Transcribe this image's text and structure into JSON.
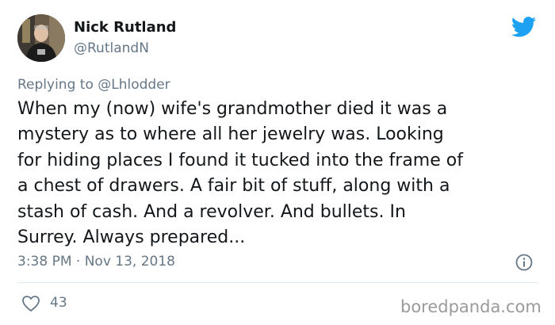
{
  "author": {
    "display_name": "Nick Rutland",
    "handle": "@RutlandN",
    "avatar_icon": "profile-photo"
  },
  "reply": {
    "prefix": "Replying to",
    "mention": "@Lhlodder"
  },
  "tweet": {
    "text": "When my (now) wife's grandmother died it was a\nmystery as to where all her jewelry was. Looking\nfor hiding places I found it tucked into the frame of\na chest of drawers. A fair bit of stuff, along with a\nstash of cash. And a revolver. And bullets. In\nSurrey. Always prepared...",
    "timestamp": "3:38 PM · Nov 13, 2018"
  },
  "stats": {
    "likes": "43"
  },
  "icons": {
    "brand": "twitter-bird-icon",
    "info": "info-icon",
    "like": "heart-icon"
  },
  "watermark": "boredpanda.com",
  "colors": {
    "twitter_blue": "#1da1f2",
    "text_primary": "#14171a",
    "text_secondary": "#657786",
    "divider": "#e1e8ed"
  }
}
